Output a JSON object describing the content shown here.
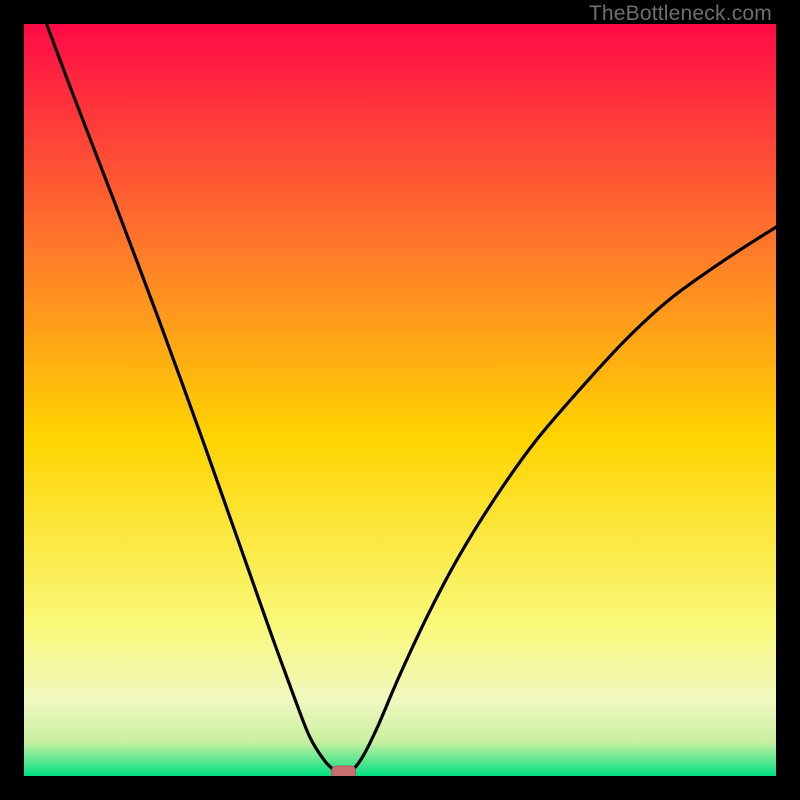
{
  "watermark": "TheBottleneck.com",
  "colors": {
    "bg_outer": "#000000",
    "curve": "#000000",
    "marker_fill": "#c86e6e",
    "marker_stroke": "#b45a5a",
    "gradient_top": "#ff0a46",
    "gradient_mid_upper": "#ff7a2a",
    "gradient_mid": "#ffd400",
    "gradient_mid_lower": "#f9f97a",
    "gradient_band": "#f0f8c0",
    "gradient_bottom": "#00e083"
  },
  "chart_data": {
    "type": "line",
    "title": "",
    "xlabel": "",
    "ylabel": "",
    "xlim": [
      0,
      100
    ],
    "ylim": [
      0,
      100
    ],
    "series": [
      {
        "name": "bottleneck-curve",
        "x": [
          3,
          6,
          9,
          12,
          15,
          18,
          21,
          24,
          27,
          30,
          33,
          36,
          38,
          40,
          41.5,
          42.5,
          43.5,
          45,
          47,
          50,
          54,
          58,
          63,
          68,
          74,
          80,
          86,
          93,
          100
        ],
        "values": [
          100,
          92,
          84.2,
          76.4,
          68.5,
          60.5,
          52.3,
          44,
          35.5,
          27,
          18.5,
          10.3,
          5.2,
          2.0,
          0.6,
          0.2,
          0.6,
          2.5,
          6.5,
          13.5,
          22.0,
          29.5,
          37.5,
          44.5,
          51.5,
          58,
          63.5,
          68.5,
          73
        ]
      }
    ],
    "marker": {
      "x": 42.5,
      "y": 0.2,
      "label": "optimal-point"
    },
    "gradient_stops": [
      {
        "offset": 0.0,
        "color": "#ff0a46"
      },
      {
        "offset": 0.3,
        "color": "#ff7a2a"
      },
      {
        "offset": 0.55,
        "color": "#ffd400"
      },
      {
        "offset": 0.8,
        "color": "#f9f97a"
      },
      {
        "offset": 0.9,
        "color": "#f0f8c0"
      },
      {
        "offset": 0.955,
        "color": "#c8f0a0"
      },
      {
        "offset": 1.0,
        "color": "#00e083"
      }
    ]
  }
}
